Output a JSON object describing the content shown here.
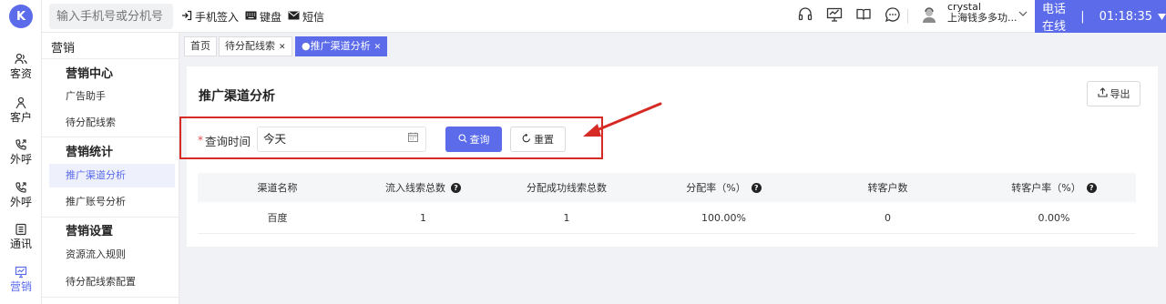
{
  "rail": {
    "logo": "K",
    "items": [
      {
        "label": "客资",
        "icon": "users-icon"
      },
      {
        "label": "客户",
        "icon": "person-icon"
      },
      {
        "label": "外呼",
        "icon": "phone-out-icon"
      },
      {
        "label": "外呼",
        "icon": "phone-out-icon"
      },
      {
        "label": "通讯",
        "icon": "contacts-icon"
      },
      {
        "label": "营销",
        "icon": "marketing-icon"
      }
    ]
  },
  "topbar": {
    "search_placeholder": "输入手机号或分机号",
    "actions": [
      {
        "label": "手机签入",
        "icon": "login-icon"
      },
      {
        "label": "键盘",
        "icon": "keyboard-icon"
      },
      {
        "label": "短信",
        "icon": "mail-icon"
      }
    ],
    "user_name": "crystal",
    "user_org": "上海钱多多功...",
    "call_status": "电话在线",
    "call_timer": "01:18:35"
  },
  "sidebar": {
    "title": "营销",
    "groups": [
      {
        "label": "营销中心",
        "items": [
          "广告助手",
          "待分配线索"
        ]
      },
      {
        "label": "营销统计",
        "items": [
          "推广渠道分析",
          "推广账号分析"
        ]
      },
      {
        "label": "营销设置",
        "items": [
          "资源流入规则",
          "待分配线索配置"
        ]
      }
    ],
    "active_item": "推广渠道分析"
  },
  "tabs": [
    {
      "label": "首页",
      "closable": false,
      "active": false
    },
    {
      "label": "待分配线索",
      "closable": true,
      "active": false
    },
    {
      "label": "●推广渠道分析",
      "closable": true,
      "active": true
    }
  ],
  "page": {
    "title": "推广渠道分析",
    "export_label": "导出",
    "filter": {
      "required_mark": "*",
      "label": "查询时间",
      "value": "今天",
      "query_label": "查询",
      "reset_label": "重置"
    },
    "table": {
      "columns": [
        "渠道名称",
        "流入线索总数",
        "分配成功线索总数",
        "分配率（%）",
        "转客户数",
        "转客户率（%）"
      ],
      "help_columns": [
        1,
        3,
        5
      ],
      "rows": [
        [
          "百度",
          "1",
          "1",
          "100.00%",
          "0",
          "0.00%"
        ]
      ]
    }
  },
  "colors": {
    "accent": "#5b6bea",
    "annotation": "#d62b24"
  }
}
